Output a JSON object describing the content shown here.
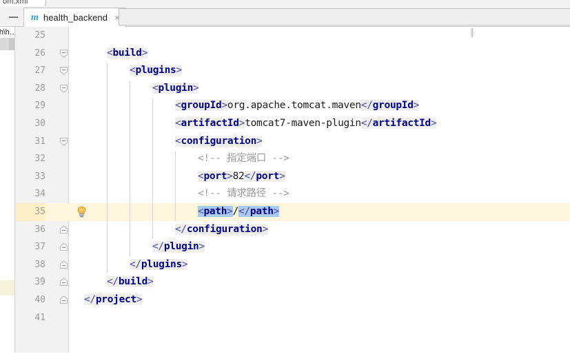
{
  "window": {
    "upper_tab_label": "om.xml"
  },
  "tabbar": {
    "hide_button_name": "hide-editor-tabs",
    "tab": {
      "icon": "m",
      "title": "health_backend",
      "close": "×"
    }
  },
  "sidebar": {
    "path_fragment": "th\\h…"
  },
  "editor": {
    "first_line_number": 25,
    "lines": [
      {
        "n": "25",
        "fold": "none",
        "indent_guides": [],
        "tokens": []
      },
      {
        "n": "26",
        "fold": "open-top",
        "indent_guides": [],
        "tokens": [
          {
            "t": "brk",
            "v": "<"
          },
          {
            "t": "tag",
            "v": "build"
          },
          {
            "t": "brk",
            "v": ">"
          }
        ],
        "indent": 4
      },
      {
        "n": "27",
        "fold": "open-top",
        "indent_guides": [
          1
        ],
        "tokens": [
          {
            "t": "brk",
            "v": "<"
          },
          {
            "t": "tag",
            "v": "plugins"
          },
          {
            "t": "brk",
            "v": ">"
          }
        ],
        "indent": 8
      },
      {
        "n": "28",
        "fold": "open-top",
        "indent_guides": [
          1,
          2
        ],
        "tokens": [
          {
            "t": "brk",
            "v": "<"
          },
          {
            "t": "tag",
            "v": "plugin"
          },
          {
            "t": "brk",
            "v": ">"
          }
        ],
        "indent": 12
      },
      {
        "n": "29",
        "fold": "none",
        "indent_guides": [
          1,
          2,
          3
        ],
        "tokens": [
          {
            "t": "brk",
            "v": "<"
          },
          {
            "t": "tag",
            "v": "groupId"
          },
          {
            "t": "brk",
            "v": ">"
          },
          {
            "t": "txt",
            "v": "org.apache.tomcat.maven"
          },
          {
            "t": "brk",
            "v": "</"
          },
          {
            "t": "tag",
            "v": "groupId"
          },
          {
            "t": "brk",
            "v": ">"
          }
        ],
        "indent": 16
      },
      {
        "n": "30",
        "fold": "none",
        "indent_guides": [
          1,
          2,
          3
        ],
        "tokens": [
          {
            "t": "brk",
            "v": "<"
          },
          {
            "t": "tag",
            "v": "artifactId"
          },
          {
            "t": "brk",
            "v": ">"
          },
          {
            "t": "txt",
            "v": "tomcat7-maven-plugin"
          },
          {
            "t": "brk",
            "v": "</"
          },
          {
            "t": "tag",
            "v": "artifactId"
          },
          {
            "t": "brk",
            "v": ">"
          }
        ],
        "indent": 16
      },
      {
        "n": "31",
        "fold": "open-top",
        "indent_guides": [
          1,
          2,
          3
        ],
        "tokens": [
          {
            "t": "brk",
            "v": "<"
          },
          {
            "t": "tag",
            "v": "configuration"
          },
          {
            "t": "brk",
            "v": ">"
          }
        ],
        "indent": 16
      },
      {
        "n": "32",
        "fold": "none",
        "indent_guides": [
          1,
          2,
          3,
          4
        ],
        "tokens": [
          {
            "t": "cmt",
            "v": "<!-- 指定端口 -->"
          }
        ],
        "indent": 20
      },
      {
        "n": "33",
        "fold": "none",
        "indent_guides": [
          1,
          2,
          3,
          4
        ],
        "tokens": [
          {
            "t": "brk",
            "v": "<"
          },
          {
            "t": "tag",
            "v": "port"
          },
          {
            "t": "brk",
            "v": ">"
          },
          {
            "t": "txt",
            "v": "82"
          },
          {
            "t": "brk",
            "v": "</"
          },
          {
            "t": "tag",
            "v": "port"
          },
          {
            "t": "brk",
            "v": ">"
          }
        ],
        "indent": 20
      },
      {
        "n": "34",
        "fold": "none",
        "indent_guides": [
          1,
          2,
          3,
          4
        ],
        "tokens": [
          {
            "t": "cmt",
            "v": "<!-- 请求路径 -->"
          }
        ],
        "indent": 20
      },
      {
        "n": "35",
        "fold": "none",
        "bulb": true,
        "current": true,
        "indent_guides": [
          1,
          2,
          3,
          4
        ],
        "tokens": [
          {
            "t": "brk",
            "v": "<",
            "sel": true
          },
          {
            "t": "tag",
            "v": "path",
            "sel": true
          },
          {
            "t": "brk",
            "v": ">",
            "sel": true
          },
          {
            "t": "txt",
            "v": "/"
          },
          {
            "t": "brk",
            "v": "</",
            "sel": true
          },
          {
            "t": "tag",
            "v": "path",
            "sel": true
          },
          {
            "t": "brk",
            "v": ">",
            "sel": true
          }
        ],
        "indent": 20
      },
      {
        "n": "36",
        "fold": "close-bottom",
        "indent_guides": [
          1,
          2,
          3
        ],
        "tokens": [
          {
            "t": "brk",
            "v": "</"
          },
          {
            "t": "tag",
            "v": "configuration"
          },
          {
            "t": "brk",
            "v": ">"
          }
        ],
        "indent": 16
      },
      {
        "n": "37",
        "fold": "close-bottom",
        "indent_guides": [
          1,
          2
        ],
        "tokens": [
          {
            "t": "brk",
            "v": "</"
          },
          {
            "t": "tag",
            "v": "plugin"
          },
          {
            "t": "brk",
            "v": ">"
          }
        ],
        "indent": 12
      },
      {
        "n": "38",
        "fold": "close-bottom",
        "indent_guides": [
          1
        ],
        "tokens": [
          {
            "t": "brk",
            "v": "</"
          },
          {
            "t": "tag",
            "v": "plugins"
          },
          {
            "t": "brk",
            "v": ">"
          }
        ],
        "indent": 8
      },
      {
        "n": "39",
        "fold": "close-bottom",
        "indent_guides": [],
        "tokens": [
          {
            "t": "brk",
            "v": "</"
          },
          {
            "t": "tag",
            "v": "build"
          },
          {
            "t": "brk",
            "v": ">"
          }
        ],
        "indent": 4
      },
      {
        "n": "40",
        "fold": "close-bottom",
        "indent_guides": [],
        "tokens": [
          {
            "t": "brk",
            "v": "</"
          },
          {
            "t": "tag",
            "v": "project"
          },
          {
            "t": "brk",
            "v": ">"
          }
        ],
        "indent": 0
      },
      {
        "n": "41",
        "fold": "none",
        "indent_guides": [],
        "tokens": []
      }
    ]
  },
  "colors": {
    "tag": "#000080",
    "bracket": "#4a4aa0",
    "comment": "#9b9b9b",
    "selection": "#a6caf0",
    "current_line": "#fdf6dd",
    "gutter_bg": "#f2f2f2",
    "token_bg": "#efefef"
  }
}
